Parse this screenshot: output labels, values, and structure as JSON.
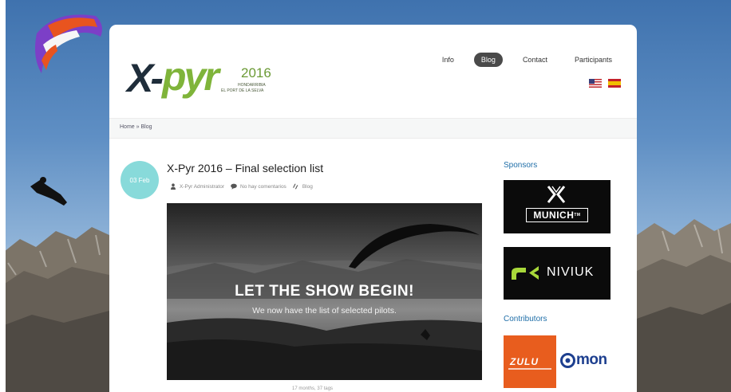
{
  "site": {
    "logo": {
      "name_x": "X-",
      "name_pyr": "pyr",
      "year": "2016",
      "subtitle_line1": "HONDARRIBIA",
      "subtitle_line2": "EL PORT DE LA SELVA",
      "primary_color": "#1f2d3a",
      "accent_color": "#7fb43a"
    }
  },
  "nav": {
    "items": [
      {
        "label": "Info",
        "active": false
      },
      {
        "label": "Blog",
        "active": true
      },
      {
        "label": "Contact",
        "active": false
      },
      {
        "label": "Participants",
        "active": false
      }
    ],
    "flags": [
      "us-flag-icon",
      "es-flag-icon"
    ]
  },
  "breadcrumb": {
    "home": "Home",
    "separator": "»",
    "current": "Blog"
  },
  "post": {
    "date": "03 Feb",
    "title": "X-Pyr 2016 – Final selection list",
    "author": "X-Pyr Administrator",
    "comments": "No hay comentarios",
    "category": "Blog",
    "hero_title": "LET THE SHOW BEGIN!",
    "hero_subtitle": "We now have the list of selected pilots.",
    "footer": "17 months, 37 tags"
  },
  "sidebar": {
    "sponsors_heading": "Sponsors",
    "sponsors": [
      {
        "name": "MUNICH",
        "mark": "TM"
      },
      {
        "name": "NIVIUK"
      }
    ],
    "contributors_heading": "Contributors",
    "contributors": [
      {
        "name": "ZULU"
      },
      {
        "name": "mon"
      }
    ]
  },
  "colors": {
    "date_badge": "#88dada",
    "link_blue": "#1f6ea8",
    "nav_active": "#4a4a4a",
    "zulu_orange": "#e85d1e"
  }
}
